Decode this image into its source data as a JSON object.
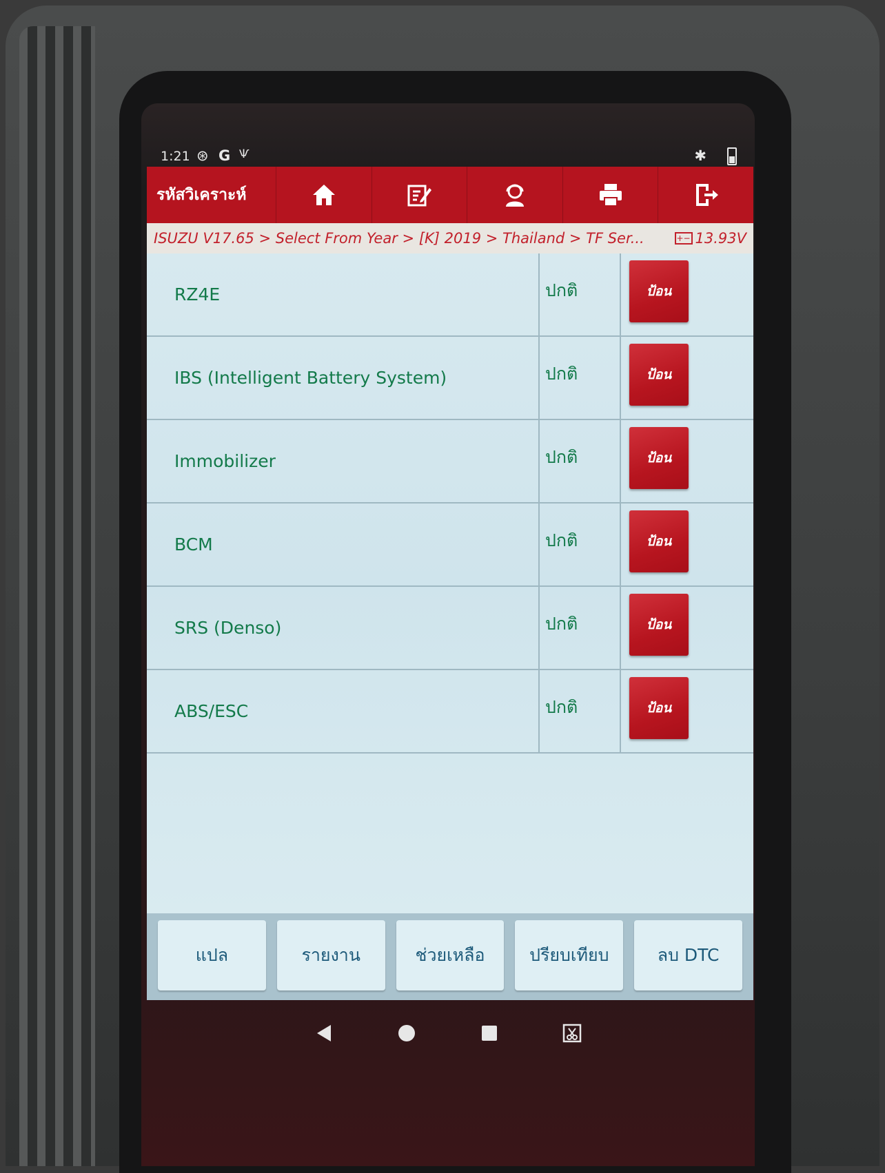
{
  "status_bar": {
    "time": "1:21",
    "icons": [
      "nfc-icon",
      "google-icon",
      "usb-icon",
      "bluetooth-icon",
      "battery-icon"
    ]
  },
  "toolbar": {
    "title": "รหัสวิเคราะห์",
    "buttons": [
      "home-icon",
      "edit-report-icon",
      "user-support-icon",
      "print-icon",
      "exit-icon"
    ]
  },
  "breadcrumb": {
    "path": "ISUZU V17.65 > Select From Year > [K] 2019 > Thailand > TF Ser...",
    "voltage": "13.93V"
  },
  "systems": [
    {
      "name": "RZ4E",
      "status": "ปกติ",
      "action": "ป้อน"
    },
    {
      "name": "IBS (Intelligent Battery System)",
      "status": "ปกติ",
      "action": "ป้อน"
    },
    {
      "name": "Immobilizer",
      "status": "ปกติ",
      "action": "ป้อน"
    },
    {
      "name": "BCM",
      "status": "ปกติ",
      "action": "ป้อน"
    },
    {
      "name": "SRS (Denso)",
      "status": "ปกติ",
      "action": "ป้อน"
    },
    {
      "name": "ABS/ESC",
      "status": "ปกติ",
      "action": "ป้อน"
    }
  ],
  "bottom_buttons": [
    "แปล",
    "รายงาน",
    "ช่วยเหลือ",
    "ปรียบเทียบ",
    "ลบ DTC"
  ],
  "colors": {
    "accent": "#b5141f",
    "list_bg": "#d7e9ef",
    "status_text": "#137a4a"
  }
}
